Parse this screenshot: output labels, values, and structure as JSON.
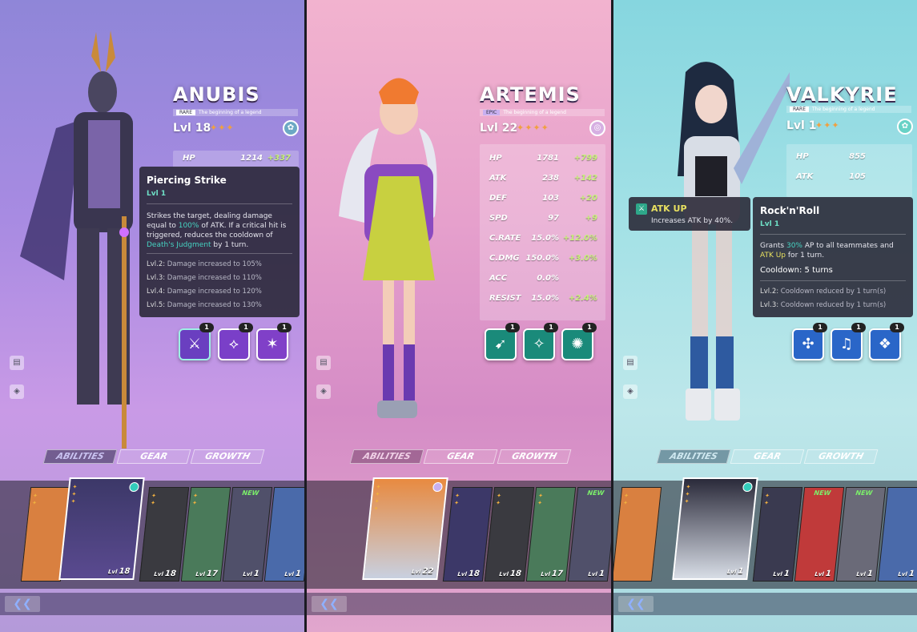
{
  "panels": [
    {
      "name": "ANUBIS",
      "rarity": "RARE",
      "tagline": "The beginning of a legend",
      "level": "Lvl 18",
      "stars": "✦✦✦",
      "stats": [
        {
          "k": "HP",
          "v": "1214",
          "b": "+337"
        }
      ],
      "tooltip": {
        "title": "Piercing Strike",
        "level": "Lvl 1",
        "desc_1": "Strikes the target, dealing damage equal to ",
        "desc_hl": "100%",
        "desc_2": " of ATK. If a critical hit is triggered, reduces the cooldown of ",
        "desc_hl2": "Death's Judgment",
        "desc_3": " by 1 turn.",
        "upgrades": [
          {
            "lv": "Lvl.2:",
            "t": " Damage increased to 105%"
          },
          {
            "lv": "Lvl.3:",
            "t": " Damage increased to 110%"
          },
          {
            "lv": "Lvl.4:",
            "t": " Damage increased to 120%"
          },
          {
            "lv": "Lvl.5:",
            "t": " Damage increased to 130%"
          }
        ]
      },
      "skill_counts": [
        "1",
        "1",
        "1"
      ],
      "tabs": [
        "ABILITIES",
        "GEAR",
        "GROWTH"
      ],
      "roster_levels": [
        "18",
        "18",
        "17",
        "1",
        "1"
      ],
      "lvl_prefix": "Lvl"
    },
    {
      "name": "ARTEMIS",
      "rarity": "EPIC",
      "tagline": "The beginning of a legend",
      "level": "Lvl 22",
      "stars": "✦✦✦✦",
      "stats": [
        {
          "k": "HP",
          "v": "1781",
          "b": "+799"
        },
        {
          "k": "ATK",
          "v": "238",
          "b": "+142"
        },
        {
          "k": "DEF",
          "v": "103",
          "b": "+20"
        },
        {
          "k": "SPD",
          "v": "97",
          "b": "+9"
        },
        {
          "k": "C.RATE",
          "v": "15.0%",
          "b": "+12.0%"
        },
        {
          "k": "C.DMG",
          "v": "150.0%",
          "b": "+3.0%"
        },
        {
          "k": "ACC",
          "v": "0.0%",
          "b": ""
        },
        {
          "k": "RESIST",
          "v": "15.0%",
          "b": "+2.4%"
        }
      ],
      "skill_counts": [
        "1",
        "1",
        "1"
      ],
      "tabs": [
        "ABILITIES",
        "GEAR",
        "GROWTH"
      ],
      "roster_levels": [
        "22",
        "18",
        "18",
        "17",
        "1"
      ],
      "lvl_prefix": "Lvl"
    },
    {
      "name": "VALKYRIE",
      "rarity": "RARE",
      "tagline": "The beginning of a legend",
      "level": "Lvl 1",
      "stars": "✦✦✦",
      "stats": [
        {
          "k": "HP",
          "v": "855",
          "b": ""
        },
        {
          "k": "ATK",
          "v": "105",
          "b": ""
        }
      ],
      "buff": {
        "title": "ATK UP",
        "desc": "Increases ATK by 40%."
      },
      "tooltip": {
        "title": "Rock'n'Roll",
        "level": "Lvl 1",
        "desc_1": "Grants ",
        "desc_hl": "30%",
        "desc_2": " AP to all teammates and ",
        "desc_hl2": "ATK Up",
        "desc_3": " for 1 turn.",
        "cooldown": "Cooldown: 5 turns",
        "upgrades": [
          {
            "lv": "Lvl.2:",
            "t": " Cooldown reduced by 1 turn(s)"
          },
          {
            "lv": "Lvl.3:",
            "t": " Cooldown reduced by 1 turn(s)"
          }
        ]
      },
      "skill_counts": [
        "1",
        "1",
        "1"
      ],
      "tabs": [
        "ABILITIES",
        "GEAR",
        "GROWTH"
      ],
      "roster_levels": [
        "1",
        "1",
        "1",
        "1",
        "1"
      ],
      "lvl_prefix": "Lvl"
    }
  ],
  "new_label": "NEW",
  "back_icon": "double-chevron-left-icon",
  "back_glyph": "❮❮",
  "colors": {
    "accent_green": "#c8f27a",
    "teal": "#46d3c2",
    "star": "#f0a040"
  }
}
